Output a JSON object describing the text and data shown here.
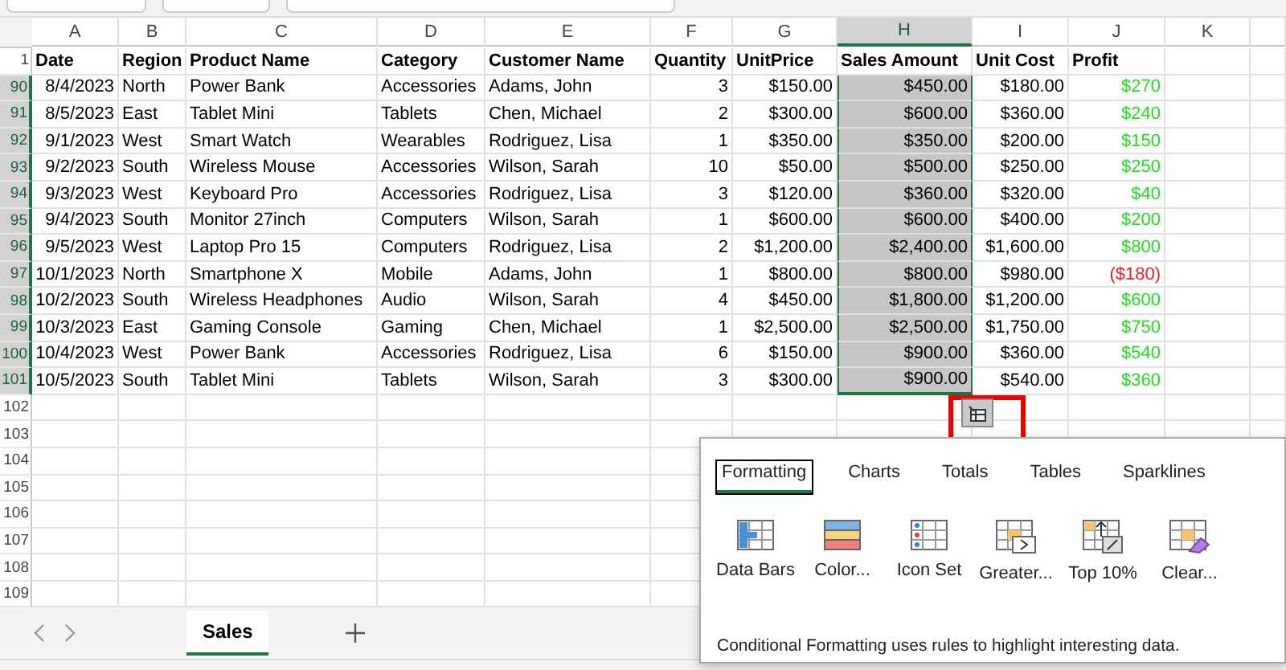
{
  "columns": [
    {
      "letter": "A",
      "selected": false
    },
    {
      "letter": "B",
      "selected": false
    },
    {
      "letter": "C",
      "selected": false
    },
    {
      "letter": "D",
      "selected": false
    },
    {
      "letter": "E",
      "selected": false
    },
    {
      "letter": "F",
      "selected": false
    },
    {
      "letter": "G",
      "selected": false
    },
    {
      "letter": "H",
      "selected": true
    },
    {
      "letter": "I",
      "selected": false
    },
    {
      "letter": "J",
      "selected": false
    },
    {
      "letter": "K",
      "selected": false
    }
  ],
  "header_row": {
    "number": "1",
    "cells": [
      "Date",
      "Region",
      "Product Name",
      "Category",
      "Customer Name",
      "Quantity",
      "UnitPrice",
      "Sales Amount",
      "Unit Cost",
      "Profit"
    ]
  },
  "rows": [
    {
      "number": "90",
      "cells": [
        "8/4/2023",
        "North",
        "Power Bank",
        "Accessories",
        "Adams, John",
        "3",
        "$150.00",
        "$450.00",
        "$180.00"
      ],
      "profit": "$270",
      "negative": false
    },
    {
      "number": "91",
      "cells": [
        "8/5/2023",
        "East",
        "Tablet Mini",
        "Tablets",
        "Chen, Michael",
        "2",
        "$300.00",
        "$600.00",
        "$360.00"
      ],
      "profit": "$240",
      "negative": false
    },
    {
      "number": "92",
      "cells": [
        "9/1/2023",
        "West",
        "Smart Watch",
        "Wearables",
        "Rodriguez, Lisa",
        "1",
        "$350.00",
        "$350.00",
        "$200.00"
      ],
      "profit": "$150",
      "negative": false
    },
    {
      "number": "93",
      "cells": [
        "9/2/2023",
        "South",
        "Wireless Mouse",
        "Accessories",
        "Wilson, Sarah",
        "10",
        "$50.00",
        "$500.00",
        "$250.00"
      ],
      "profit": "$250",
      "negative": false
    },
    {
      "number": "94",
      "cells": [
        "9/3/2023",
        "West",
        "Keyboard Pro",
        "Accessories",
        "Rodriguez, Lisa",
        "3",
        "$120.00",
        "$360.00",
        "$320.00"
      ],
      "profit": "$40",
      "negative": false
    },
    {
      "number": "95",
      "cells": [
        "9/4/2023",
        "South",
        "Monitor 27inch",
        "Computers",
        "Wilson, Sarah",
        "1",
        "$600.00",
        "$600.00",
        "$400.00"
      ],
      "profit": "$200",
      "negative": false
    },
    {
      "number": "96",
      "cells": [
        "9/5/2023",
        "West",
        "Laptop Pro 15",
        "Computers",
        "Rodriguez, Lisa",
        "2",
        "$1,200.00",
        "$2,400.00",
        "$1,600.00"
      ],
      "profit": "$800",
      "negative": false
    },
    {
      "number": "97",
      "cells": [
        "10/1/2023",
        "North",
        "Smartphone X",
        "Mobile",
        "Adams, John",
        "1",
        "$800.00",
        "$800.00",
        "$980.00"
      ],
      "profit": "($180)",
      "negative": true
    },
    {
      "number": "98",
      "cells": [
        "10/2/2023",
        "South",
        "Wireless Headphones",
        "Audio",
        "Wilson, Sarah",
        "4",
        "$450.00",
        "$1,800.00",
        "$1,200.00"
      ],
      "profit": "$600",
      "negative": false
    },
    {
      "number": "99",
      "cells": [
        "10/3/2023",
        "East",
        "Gaming Console",
        "Gaming",
        "Chen, Michael",
        "1",
        "$2,500.00",
        "$2,500.00",
        "$1,750.00"
      ],
      "profit": "$750",
      "negative": false
    },
    {
      "number": "100",
      "cells": [
        "10/4/2023",
        "West",
        "Power Bank",
        "Accessories",
        "Rodriguez, Lisa",
        "6",
        "$150.00",
        "$900.00",
        "$360.00"
      ],
      "profit": "$540",
      "negative": false
    },
    {
      "number": "101",
      "cells": [
        "10/5/2023",
        "South",
        "Tablet Mini",
        "Tablets",
        "Wilson, Sarah",
        "3",
        "$300.00",
        "$900.00",
        "$540.00"
      ],
      "profit": "$360",
      "negative": false
    }
  ],
  "empty_rows": [
    "102",
    "103",
    "104",
    "105",
    "106",
    "107",
    "108",
    "109"
  ],
  "quick_analysis": {
    "tabs": [
      {
        "label": "Formatting",
        "selected": true
      },
      {
        "label": "Charts",
        "selected": false
      },
      {
        "label": "Totals",
        "selected": false
      },
      {
        "label": "Tables",
        "selected": false
      },
      {
        "label": "Sparklines",
        "selected": false
      }
    ],
    "options": [
      {
        "kind": "databars",
        "label": "Data Bars"
      },
      {
        "kind": "colorscale",
        "label": "Color..."
      },
      {
        "kind": "iconset",
        "label": "Icon Set"
      },
      {
        "kind": "greater",
        "label": "Greater..."
      },
      {
        "kind": "top",
        "label": "Top 10%"
      },
      {
        "kind": "clear",
        "label": "Clear..."
      }
    ],
    "description": "Conditional Formatting uses rules to highlight interesting data."
  },
  "sheet_tabs": [
    {
      "label": "Sales",
      "selected": true
    }
  ]
}
